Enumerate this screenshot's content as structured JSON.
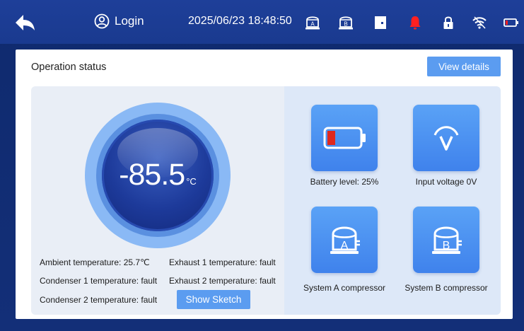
{
  "header": {
    "login_label": "Login",
    "datetime": "2025/06/23 18:48:50",
    "icons": [
      "back-arrow-icon",
      "user-icon",
      "compressor-a-icon",
      "compressor-b-icon",
      "door-icon",
      "alarm-bell-icon",
      "lock-icon",
      "wifi-icon",
      "battery-icon"
    ],
    "alarm_color": "#ff2020"
  },
  "panel": {
    "title": "Operation status",
    "view_details_label": "View details"
  },
  "gauge": {
    "value": "-85.5",
    "unit": "°C"
  },
  "temperatures": {
    "ambient": "Ambient temperature: 25.7℃",
    "exhaust1": "Exhaust 1 temperature: fault",
    "condenser1": "Condenser 1 temperature: fault",
    "exhaust2": "Exhaust 2 temperature: fault",
    "condenser2": "Condenser 2 temperature: fault"
  },
  "show_sketch_label": "Show Sketch",
  "tiles": {
    "battery": {
      "label": "Battery level: 25%",
      "level_fraction": 0.25,
      "fill_color": "#e0281e"
    },
    "voltage": {
      "label": "Input voltage 0V"
    },
    "system_a": {
      "label": "System A compressor",
      "letter": "A"
    },
    "system_b": {
      "label": "System B compressor",
      "letter": "B"
    }
  },
  "colors": {
    "accent": "#5b9cf0",
    "topbar": "#1e3f99"
  }
}
